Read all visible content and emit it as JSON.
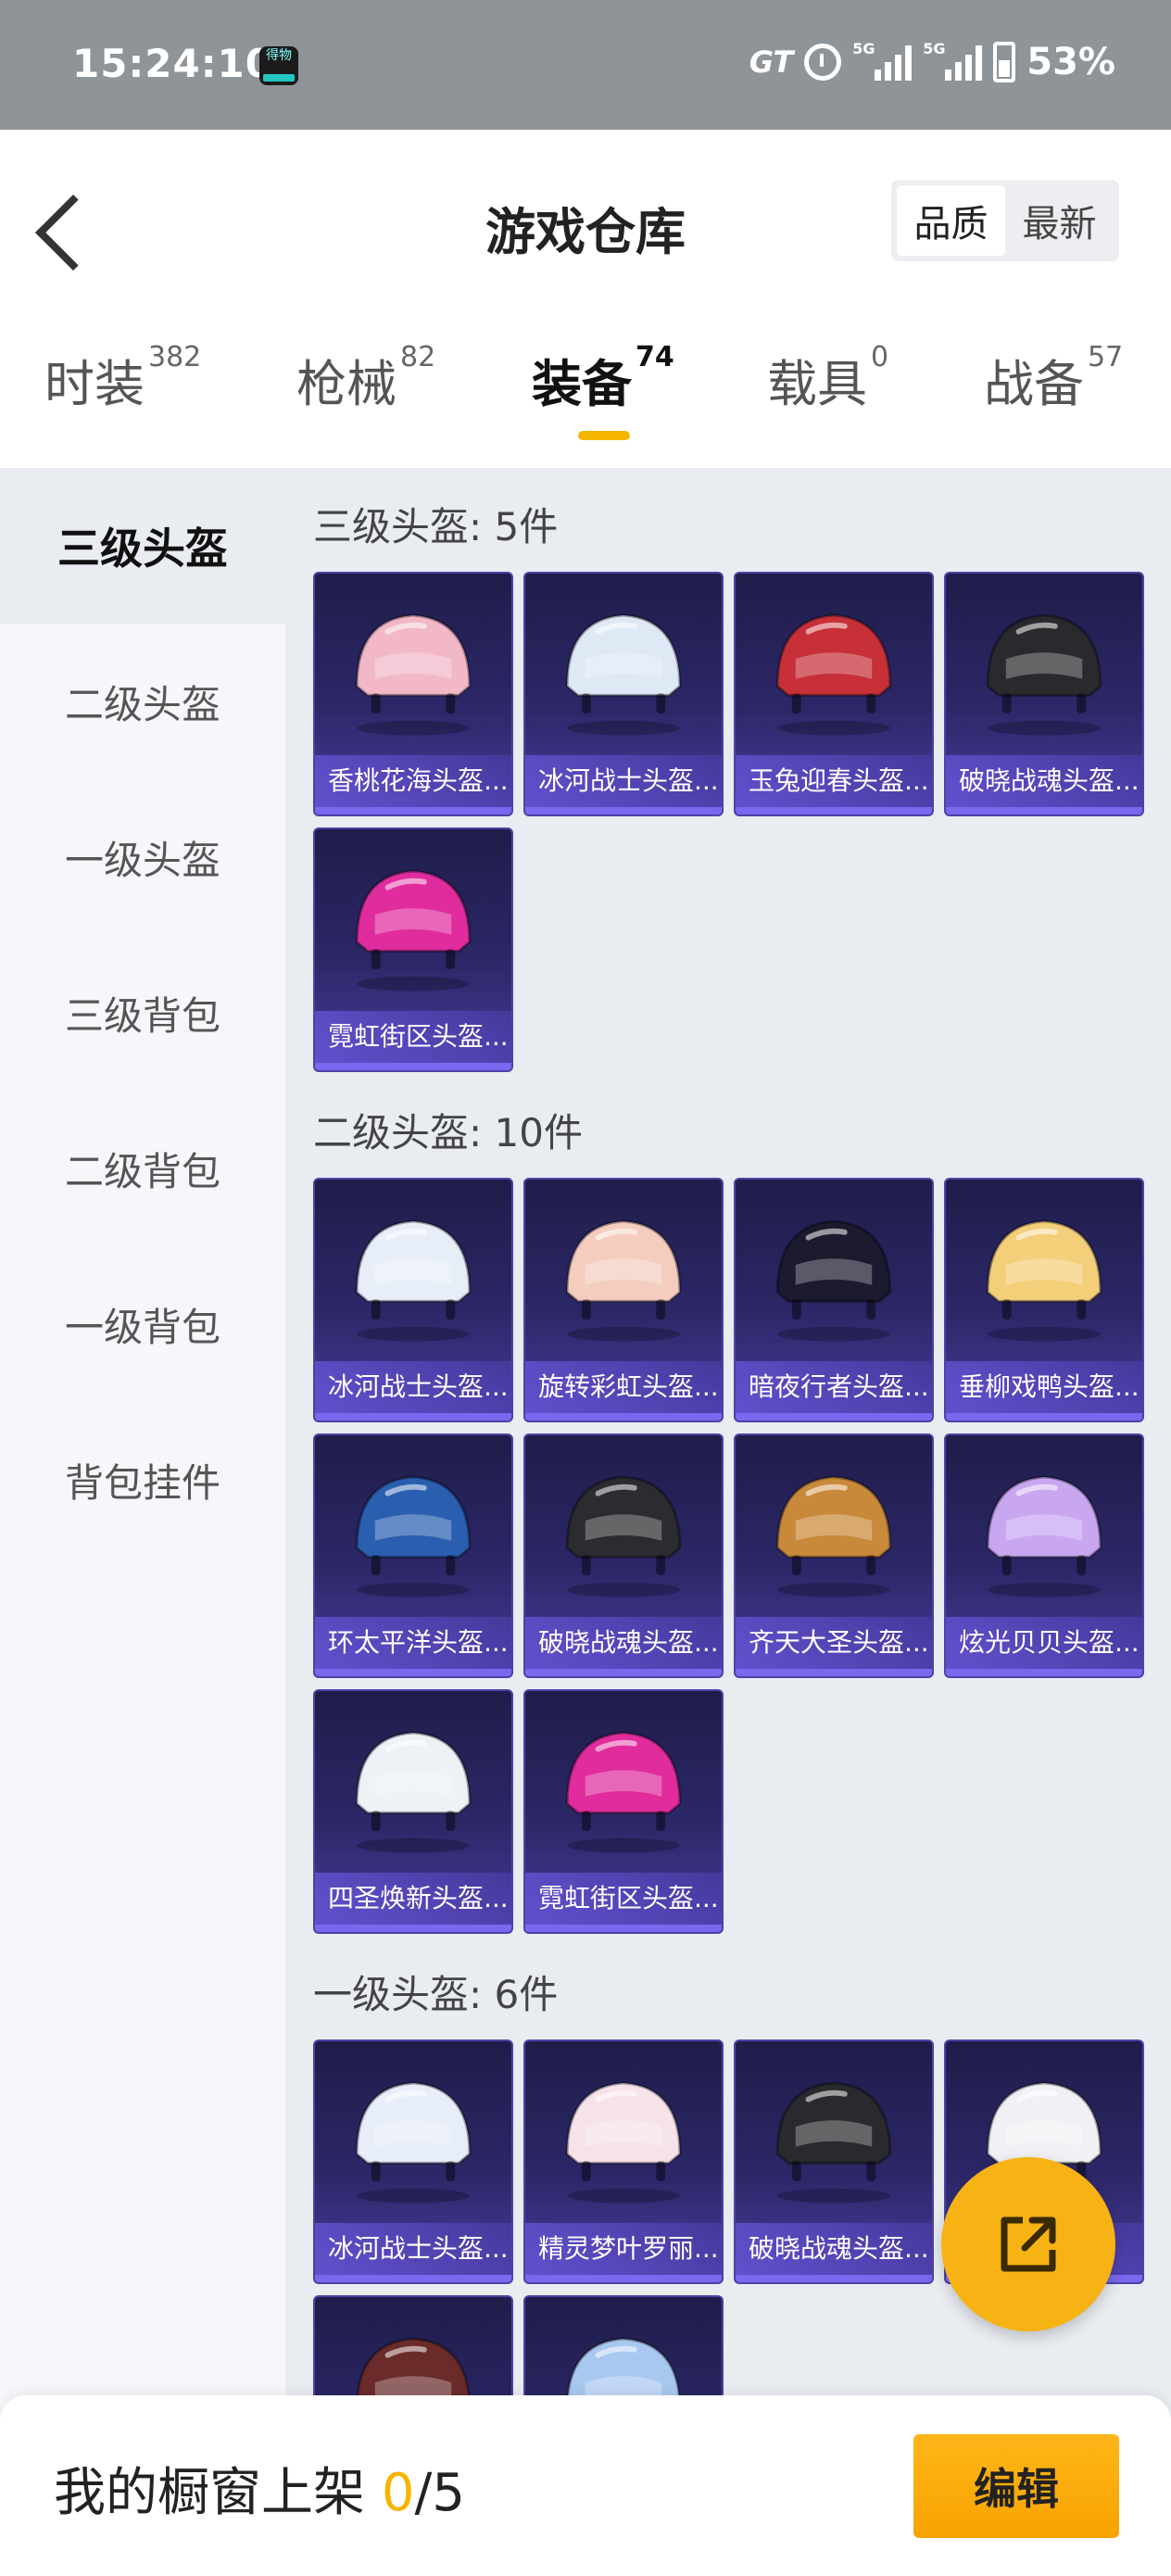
{
  "status_bar": {
    "time": "15:24:10",
    "app_icon_text": "得物",
    "network_badge_1": "5G",
    "network_badge_2": "5G",
    "carrier_mark": "GT",
    "battery": "53%"
  },
  "header": {
    "title": "游戏仓库",
    "sort_options": [
      "品质",
      "最新"
    ],
    "sort_selected": "品质"
  },
  "tabs": [
    {
      "label": "时装",
      "count": "382"
    },
    {
      "label": "枪械",
      "count": "82"
    },
    {
      "label": "装备",
      "count": "74",
      "active": true
    },
    {
      "label": "载具",
      "count": "0"
    },
    {
      "label": "战备",
      "count": "57"
    }
  ],
  "sidebar": {
    "items": [
      "三级头盔",
      "二级头盔",
      "一级头盔",
      "三级背包",
      "二级背包",
      "一级背包",
      "背包挂件"
    ],
    "active": "三级头盔"
  },
  "sections": [
    {
      "title": "三级头盔: 5件",
      "items": [
        {
          "name": "香桃花海头盔...",
          "color": "#f2b8c8"
        },
        {
          "name": "冰河战士头盔...",
          "color": "#dfe8f5"
        },
        {
          "name": "玉兔迎春头盔...",
          "color": "#c73038"
        },
        {
          "name": "破晓战魂头盔...",
          "color": "#2a2a2e"
        },
        {
          "name": "霓虹街区头盔...",
          "color": "#e12c9e"
        }
      ]
    },
    {
      "title": "二级头盔: 10件",
      "items": [
        {
          "name": "冰河战士头盔...",
          "color": "#e8eef8"
        },
        {
          "name": "旋转彩虹头盔...",
          "color": "#f4cdbf"
        },
        {
          "name": "暗夜行者头盔...",
          "color": "#1c1a2e"
        },
        {
          "name": "垂柳戏鸭头盔...",
          "color": "#f4cf7a"
        },
        {
          "name": "环太平洋头盔...",
          "color": "#2a5fb0"
        },
        {
          "name": "破晓战魂头盔...",
          "color": "#2b2b30"
        },
        {
          "name": "齐天大圣头盔...",
          "color": "#c9893a"
        },
        {
          "name": "炫光贝贝头盔...",
          "color": "#c8a6f0"
        },
        {
          "name": "四圣焕新头盔...",
          "color": "#eef1f6"
        },
        {
          "name": "霓虹街区头盔...",
          "color": "#e02c9d"
        }
      ]
    },
    {
      "title": "一级头盔: 6件",
      "items": [
        {
          "name": "冰河战士头盔...",
          "color": "#e7eef9"
        },
        {
          "name": "精灵梦叶罗丽...",
          "color": "#f6e3ea"
        },
        {
          "name": "破晓战魂头盔...",
          "color": "#2a2a2e"
        },
        {
          "name": "",
          "color": "#f1f1f5"
        },
        {
          "name": "",
          "color": "#6b2b2b"
        },
        {
          "name": "",
          "color": "#a9c8f0"
        }
      ]
    }
  ],
  "bottom_bar": {
    "label_prefix": "我的橱窗上架 ",
    "count_current": "0",
    "count_total": "/5",
    "edit_button": "编辑"
  },
  "fab": {
    "icon": "share-icon"
  },
  "colors": {
    "accent": "#f5b400",
    "card_top": "#1f1d4a",
    "card_bottom": "#4a3ea0"
  }
}
